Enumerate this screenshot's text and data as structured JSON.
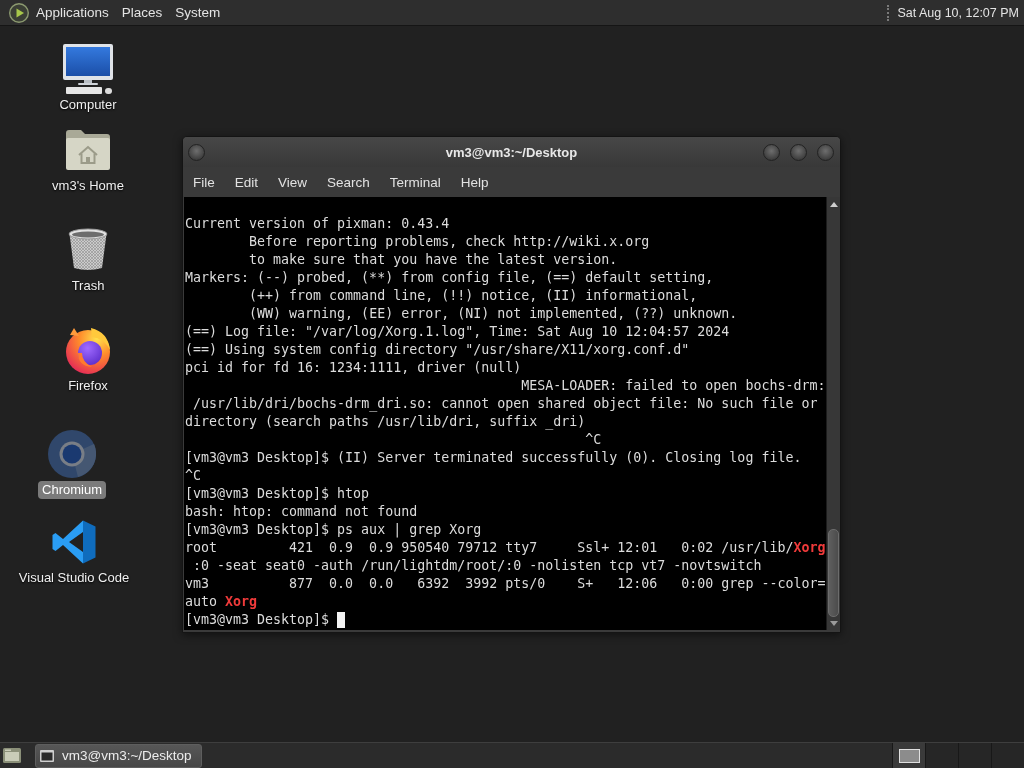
{
  "top_panel": {
    "menus": [
      "Applications",
      "Places",
      "System"
    ],
    "clock": "Sat Aug 10, 12:07 PM"
  },
  "desktop_icons": [
    {
      "label": "Computer",
      "kind": "computer",
      "selected": false
    },
    {
      "label": "vm3's Home",
      "kind": "home",
      "selected": false
    },
    {
      "label": "Trash",
      "kind": "trash",
      "selected": false
    },
    {
      "label": "Firefox",
      "kind": "firefox",
      "selected": false
    },
    {
      "label": "Chromium",
      "kind": "chromium",
      "selected": true
    },
    {
      "label": "Visual Studio Code",
      "kind": "vscode",
      "selected": false
    }
  ],
  "terminal_window": {
    "title": "vm3@vm3:~/Desktop",
    "menu": [
      "File",
      "Edit",
      "View",
      "Search",
      "Terminal",
      "Help"
    ],
    "lines": [
      "Current version of pixman: 0.43.4",
      "        Before reporting problems, check http://wiki.x.org",
      "        to make sure that you have the latest version.",
      "Markers: (--) probed, (**) from config file, (==) default setting,",
      "        (++) from command line, (!!) notice, (II) informational,",
      "        (WW) warning, (EE) error, (NI) not implemented, (??) unknown.",
      "(==) Log file: \"/var/log/Xorg.1.log\", Time: Sat Aug 10 12:04:57 2024",
      "(==) Using system config directory \"/usr/share/X11/xorg.conf.d\"",
      "pci id for fd 16: 1234:1111, driver (null)",
      "                                          MESA-LOADER: failed to open bochs-drm:",
      " /usr/lib/dri/bochs-drm_dri.so: cannot open shared object file: No such file or",
      "directory (search paths /usr/lib/dri, suffix _dri)",
      "                                                  ^C",
      "[vm3@vm3 Desktop]$ (II) Server terminated successfully (0). Closing log file.",
      "^C",
      "[vm3@vm3 Desktop]$ htop",
      "bash: htop: command not found",
      "[vm3@vm3 Desktop]$ ps aux | grep Xorg",
      "root         421  0.9  0.9 950540 79712 tty7     Ssl+ 12:01   0:02 /usr/lib/**Xorg**",
      " :0 -seat seat0 -auth /run/lightdm/root/:0 -nolisten tcp vt7 -novtswitch",
      "vm3          877  0.0  0.0   6392  3992 pts/0    S+   12:06   0:00 grep --color=",
      "auto **Xorg**"
    ],
    "prompt": "[vm3@vm3 Desktop]$",
    "cursor": true
  },
  "bottom_panel": {
    "tasks": [
      {
        "label": "vm3@vm3:~/Desktop",
        "selected": true
      }
    ],
    "workspaces": [
      {
        "selected": true
      },
      {
        "selected": false
      },
      {
        "selected": false
      },
      {
        "selected": false
      }
    ]
  }
}
